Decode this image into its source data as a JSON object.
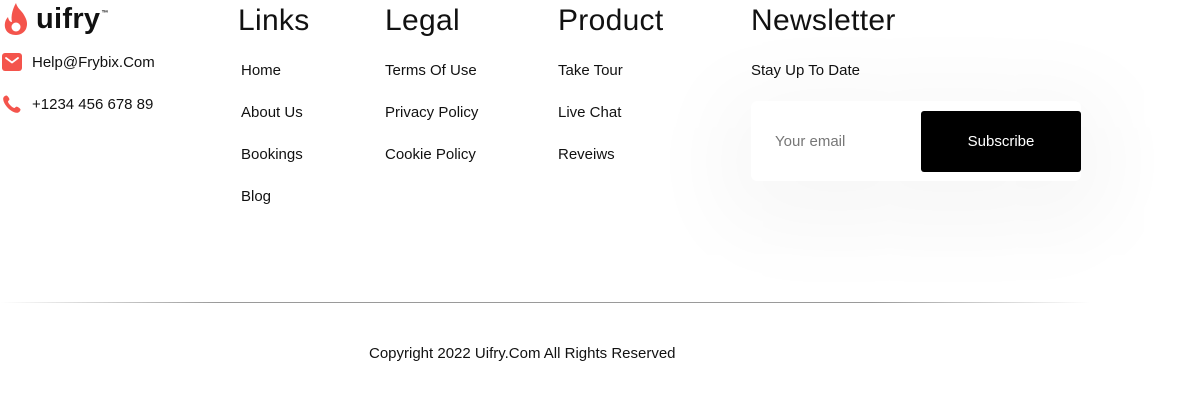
{
  "brand": {
    "name": "uifry",
    "trademark": "™",
    "icon": "flame-icon",
    "accent_color": "#f4544c"
  },
  "contact": {
    "email": "Help@Frybix.Com",
    "email_icon": "mail-icon",
    "phone": "+1234 456 678 89",
    "phone_icon": "phone-icon"
  },
  "links": {
    "title": "Links",
    "items": [
      "Home",
      "About Us",
      "Bookings",
      "Blog"
    ]
  },
  "legal": {
    "title": "Legal",
    "items": [
      "Terms Of Use",
      "Privacy Policy",
      "Cookie Policy"
    ]
  },
  "product": {
    "title": "Product",
    "items": [
      "Take Tour",
      "Live Chat",
      "Reveiws"
    ]
  },
  "newsletter": {
    "title": "Newsletter",
    "subtitle": "Stay Up To Date",
    "email_placeholder": "Your email",
    "email_value": "",
    "subscribe_label": "Subscribe"
  },
  "footer": {
    "copyright": "Copyright 2022 Uifry.Com All Rights Reserved"
  }
}
